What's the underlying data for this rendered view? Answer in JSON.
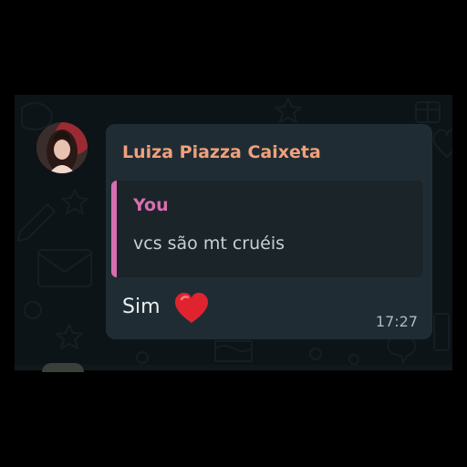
{
  "message": {
    "sender_name": "Luiza Piazza Caixeta",
    "quoted": {
      "author": "You",
      "text": "vcs são mt cruéis"
    },
    "text": "Sim",
    "emoji_icon": "red-heart-icon",
    "time": "17:27"
  },
  "colors": {
    "wallpaper": "#0d1418",
    "bubble": "#202c33",
    "quote_background": "#1b2428",
    "sender_name": "#f0a07c",
    "quote_accent": "#d86eb2",
    "message_text": "#e9edef",
    "timestamp": "#aebac1",
    "heart": "#e0242f"
  }
}
